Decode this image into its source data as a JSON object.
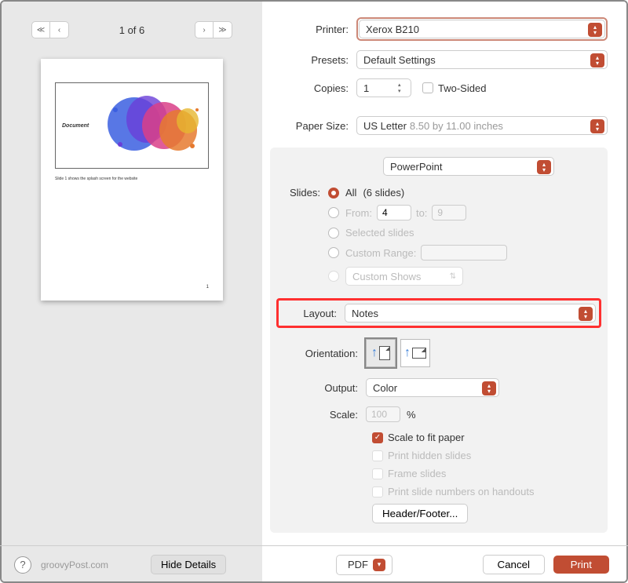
{
  "nav": {
    "page_indicator": "1 of 6"
  },
  "preview": {
    "doc_label": "Document",
    "caption": "Slide 1 shows the splash screen for the website",
    "pagenum": "1"
  },
  "left_footer": {
    "watermark": "groovyPost.com",
    "hide_details": "Hide Details"
  },
  "footer": {
    "pdf": "PDF",
    "cancel": "Cancel",
    "print": "Print"
  },
  "printer": {
    "label": "Printer:",
    "value": "Xerox B210"
  },
  "presets": {
    "label": "Presets:",
    "value": "Default Settings"
  },
  "copies": {
    "label": "Copies:",
    "value": "1",
    "two_sided": "Two-Sided"
  },
  "paper": {
    "label": "Paper Size:",
    "value": "US Letter",
    "dims": "8.50 by 11.00 inches"
  },
  "app": {
    "label": "PowerPoint"
  },
  "slides": {
    "label": "Slides:",
    "all": "All",
    "all_count": "(6 slides)",
    "from": "From:",
    "from_val": "4",
    "to": "to:",
    "to_val": "9",
    "selected": "Selected slides",
    "custom_range": "Custom Range:",
    "custom_shows": "Custom Shows"
  },
  "layout": {
    "label": "Layout:",
    "value": "Notes"
  },
  "orientation": {
    "label": "Orientation:"
  },
  "output": {
    "label": "Output:",
    "value": "Color"
  },
  "scale": {
    "label": "Scale:",
    "value": "100",
    "percent": "%"
  },
  "opts": {
    "fit": "Scale to fit paper",
    "hidden": "Print hidden slides",
    "frame": "Frame slides",
    "nums": "Print slide numbers on handouts"
  },
  "headerfooter": "Header/Footer..."
}
